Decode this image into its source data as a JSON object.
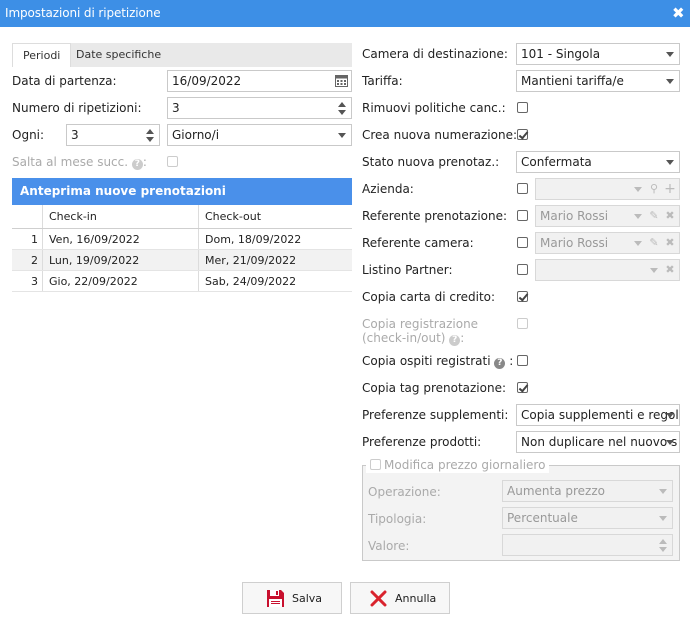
{
  "window": {
    "title": "Impostazioni di ripetizione",
    "close_icon": "close-icon"
  },
  "tabs": [
    {
      "label": "Periodi",
      "active": true
    },
    {
      "label": "Date specifiche",
      "active": false
    }
  ],
  "left": {
    "start_date": {
      "label": "Data di partenza:",
      "value": "16/09/2022"
    },
    "repetitions": {
      "label": "Numero di ripetizioni:",
      "value": "3"
    },
    "every": {
      "label": "Ogni:",
      "value": "3",
      "unit": "Giorno/i"
    },
    "skip_month": {
      "label": "Salta al mese succ.",
      "suffix": ":",
      "checked": false
    }
  },
  "preview": {
    "title": "Anteprima nuove prenotazioni",
    "columns": [
      "Check-in",
      "Check-out"
    ],
    "rows": [
      {
        "n": "1",
        "checkin": "Ven, 16/09/2022",
        "checkout": "Dom, 18/09/2022"
      },
      {
        "n": "2",
        "checkin": "Lun, 19/09/2022",
        "checkout": "Mer, 21/09/2022"
      },
      {
        "n": "3",
        "checkin": "Gio, 22/09/2022",
        "checkout": "Sab, 24/09/2022"
      }
    ]
  },
  "right": {
    "room": {
      "label": "Camera di destinazione:",
      "value": "101 - Singola"
    },
    "rate": {
      "label": "Tariffa:",
      "value": "Mantieni tariffa/e"
    },
    "remove_policies": {
      "label": "Rimuovi politiche canc.:",
      "checked": false
    },
    "new_numbering": {
      "label": "Crea nuova numerazione:",
      "checked": true
    },
    "status": {
      "label": "Stato nuova prenotaz.:",
      "value": "Confermata"
    },
    "company": {
      "label": "Azienda:",
      "checked": false,
      "value": ""
    },
    "booking_contact": {
      "label": "Referente prenotazione:",
      "checked": false,
      "value": "Mario Rossi"
    },
    "room_contact": {
      "label": "Referente camera:",
      "checked": false,
      "value": "Mario Rossi"
    },
    "partner_list": {
      "label": "Listino Partner:",
      "checked": false,
      "value": ""
    },
    "copy_card": {
      "label": "Copia carta di credito:",
      "checked": true
    },
    "copy_registration": {
      "label_line1": "Copia registrazione",
      "label_line2": "(check-in/out)",
      "suffix": ":",
      "checked": false
    },
    "copy_guests": {
      "label": "Copia ospiti registrati",
      "suffix": ":",
      "checked": false
    },
    "copy_tags": {
      "label": "Copia tag prenotazione:",
      "checked": true
    },
    "supplements": {
      "label": "Preferenze supplementi:",
      "value": "Copia supplementi e regol"
    },
    "products": {
      "label": "Preferenze prodotti:",
      "value": "Non duplicare nel nuovo s"
    }
  },
  "daily_price": {
    "legend": "Modifica prezzo giornaliero",
    "checked": false,
    "operation": {
      "label": "Operazione:",
      "value": "Aumenta prezzo"
    },
    "type": {
      "label": "Tipologia:",
      "value": "Percentuale"
    },
    "value": {
      "label": "Valore:",
      "value": ""
    }
  },
  "buttons": {
    "save": "Salva",
    "cancel": "Annulla"
  },
  "colors": {
    "accent": "#3d8fe6",
    "preview_header": "#4a90ea",
    "save_icon": "#c8102e",
    "cancel_icon": "#d9232d"
  }
}
